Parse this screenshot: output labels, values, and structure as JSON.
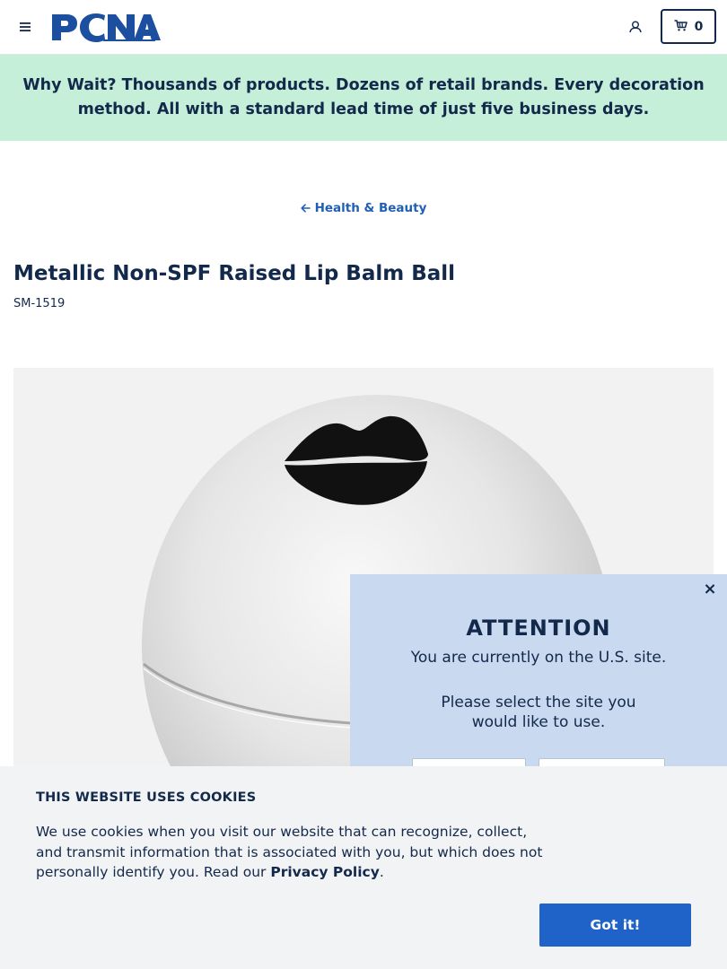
{
  "header": {
    "menu_icon": "hamburger-menu-icon",
    "logo_text": "PCNA",
    "account_icon": "user-icon",
    "cart_icon": "cart-icon",
    "cart_count": "0"
  },
  "banner": {
    "lead": "Why Wait?",
    "text": " Thousands of products. Dozens of retail brands. Every decoration method. All with a standard lead time of just five business days."
  },
  "breadcrumb": {
    "back_icon": "arrow-left-icon",
    "label": "Health & Beauty"
  },
  "product": {
    "title": "Metallic Non-SPF Raised Lip Balm Ball",
    "sku": "SM-1519"
  },
  "attention": {
    "close_icon": "close-icon",
    "close_label": "×",
    "heading": "ATTENTION",
    "message": "You are currently on the U.S. site.",
    "prompt": "Please select the site you would like to use."
  },
  "cookies": {
    "title": "THIS WEBSITE USES COOKIES",
    "text": "We use cookies when you visit our website that can recognize, collect, and transmit information that is associated with you, but which does not personally identify you. Read our ",
    "link": "Privacy Policy",
    "after": ".",
    "button": "Got it!"
  },
  "colors": {
    "navy": "#13294b",
    "accent_blue": "#1f63c9",
    "banner_green": "#c5efd9",
    "attention_blue": "#c9d9ef"
  }
}
